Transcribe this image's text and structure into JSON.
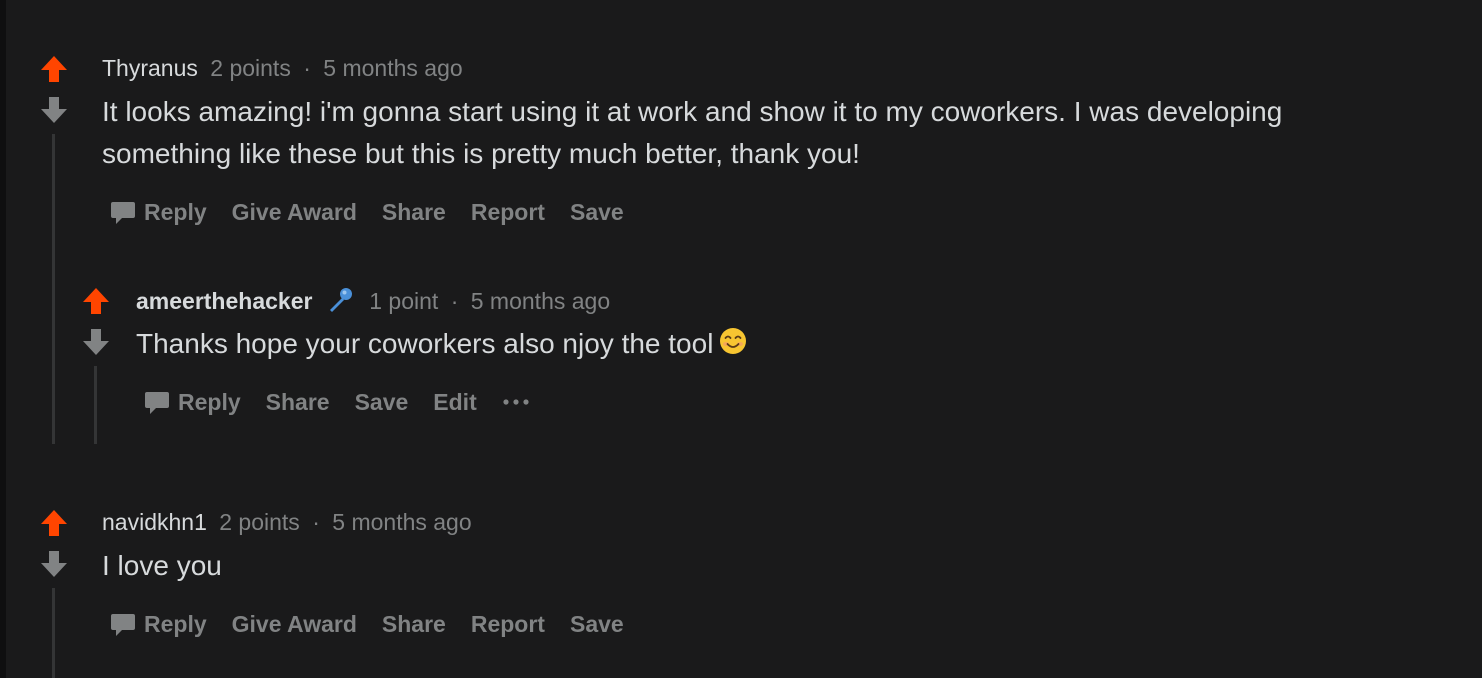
{
  "comments": [
    {
      "author": "Thyranus",
      "points": "2 points",
      "separator": "·",
      "time": "5 months ago",
      "body": "It looks amazing! i'm gonna start using it at work and show it to my coworkers. I was developing something like these but this is pretty much better, thank you!",
      "actions": {
        "reply": "Reply",
        "award": "Give Award",
        "share": "Share",
        "report": "Report",
        "save": "Save"
      }
    },
    {
      "author": "ameerthehacker",
      "flair_icon": "microphone-icon",
      "points": "1 point",
      "separator": "·",
      "time": "5 months ago",
      "body": "Thanks hope your coworkers also njoy the tool",
      "emoji_icon": "smiling-face-emoji",
      "actions": {
        "reply": "Reply",
        "share": "Share",
        "save": "Save",
        "edit": "Edit",
        "more": "•••"
      }
    },
    {
      "author": "navidkhn1",
      "points": "2 points",
      "separator": "·",
      "time": "5 months ago",
      "body": "I love you",
      "actions": {
        "reply": "Reply",
        "award": "Give Award",
        "share": "Share",
        "report": "Report",
        "save": "Save"
      }
    }
  ],
  "colors": {
    "background": "#1a1a1b",
    "upvote": "#ff4500",
    "downvote": "#818384",
    "text": "#d7dadc",
    "muted": "#818384",
    "thread_line": "#343536"
  },
  "icons": [
    "upvote-arrow-icon",
    "downvote-arrow-icon",
    "reply-bubble-icon",
    "microphone-icon",
    "smiling-face-emoji",
    "more-options-icon"
  ]
}
